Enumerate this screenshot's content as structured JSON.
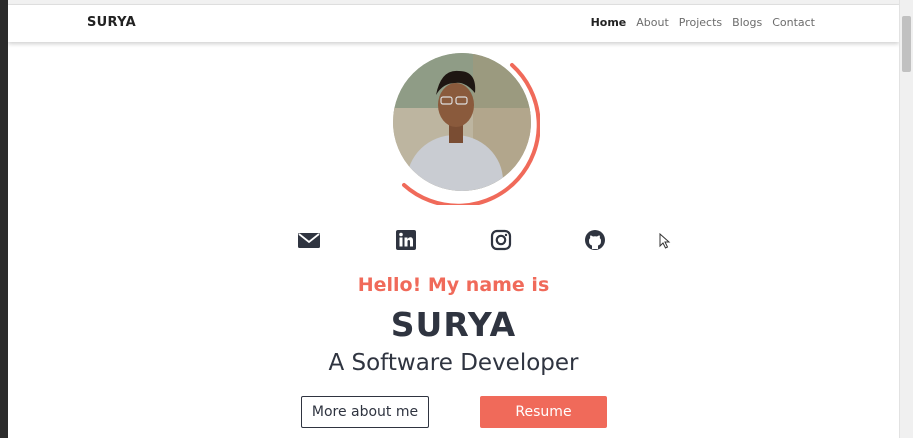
{
  "navbar": {
    "brand": "SURYA",
    "links": [
      {
        "label": "Home",
        "active": true
      },
      {
        "label": "About",
        "active": false
      },
      {
        "label": "Projects",
        "active": false
      },
      {
        "label": "Blogs",
        "active": false
      },
      {
        "label": "Contact",
        "active": false
      }
    ]
  },
  "hero": {
    "greeting": "Hello! My name is",
    "name": "SURYA",
    "role": "A Software Developer",
    "buttons": {
      "more_about": "More about me",
      "resume": "Resume"
    }
  },
  "social_icons": [
    "email-icon",
    "linkedin-icon",
    "instagram-icon",
    "github-icon"
  ],
  "colors": {
    "accent": "#f06a5a",
    "text_dark": "#2f3440",
    "nav_text": "#6c6c6c"
  }
}
